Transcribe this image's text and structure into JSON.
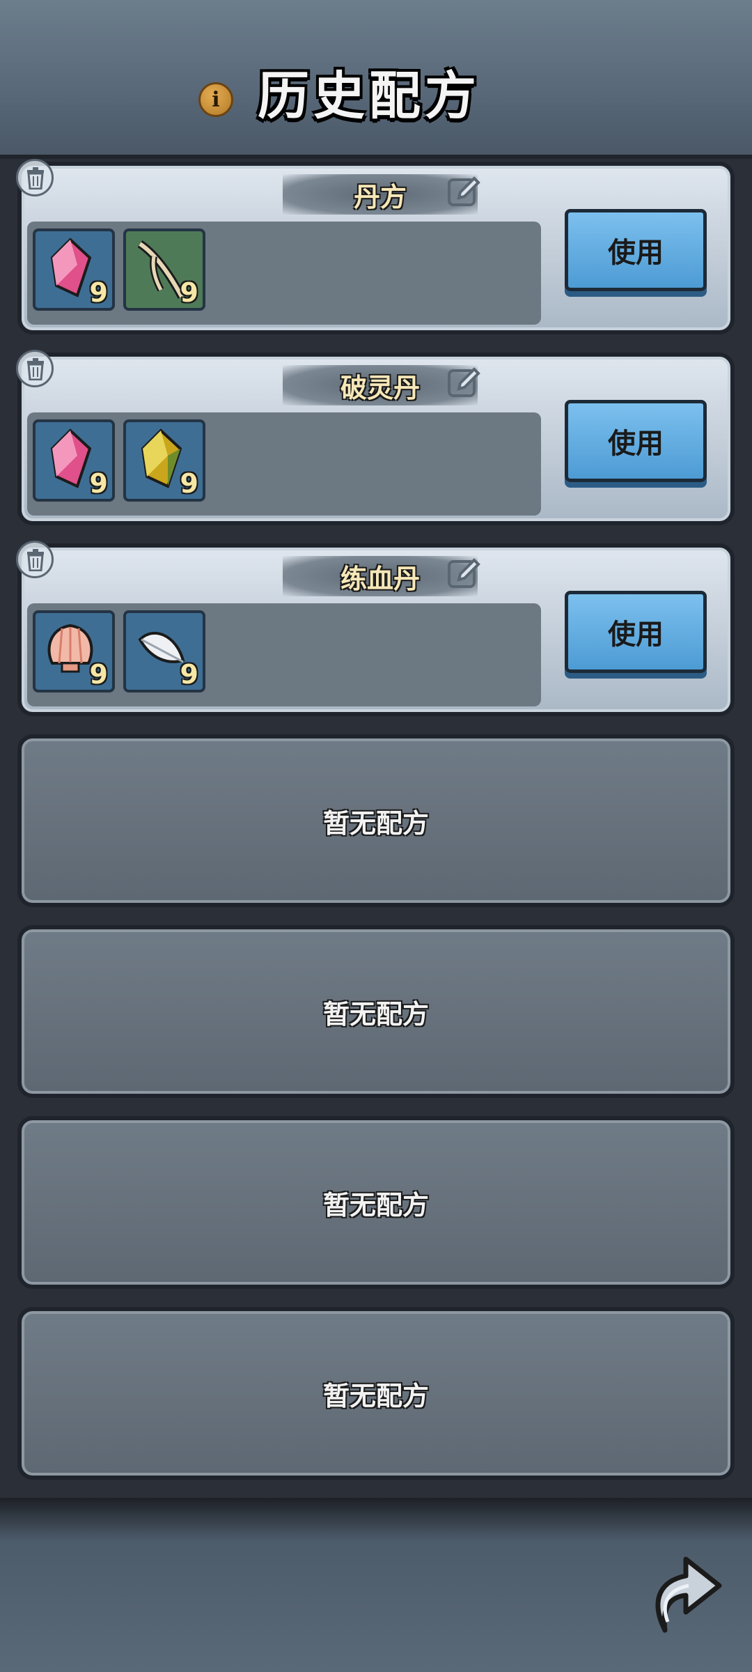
{
  "header": {
    "title": "历史配方",
    "info_icon": "info-icon"
  },
  "recipes": [
    {
      "name": "丹方",
      "use_label": "使用",
      "items": [
        {
          "icon": "pink-crystal-icon",
          "count": "9"
        },
        {
          "icon": "branch-icon",
          "count": "9"
        }
      ]
    },
    {
      "name": "破灵丹",
      "use_label": "使用",
      "items": [
        {
          "icon": "pink-crystal-icon",
          "count": "9"
        },
        {
          "icon": "yellow-crystal-icon",
          "count": "9"
        }
      ]
    },
    {
      "name": "练血丹",
      "use_label": "使用",
      "items": [
        {
          "icon": "shell-icon",
          "count": "9"
        },
        {
          "icon": "feather-icon",
          "count": "9"
        }
      ]
    }
  ],
  "empty_slots": [
    "暂无配方",
    "暂无配方",
    "暂无配方",
    "暂无配方"
  ],
  "colors": {
    "button_blue": "#5aa8de",
    "title_text": "#f6e7b8",
    "count_text": "#f6e7a6"
  }
}
